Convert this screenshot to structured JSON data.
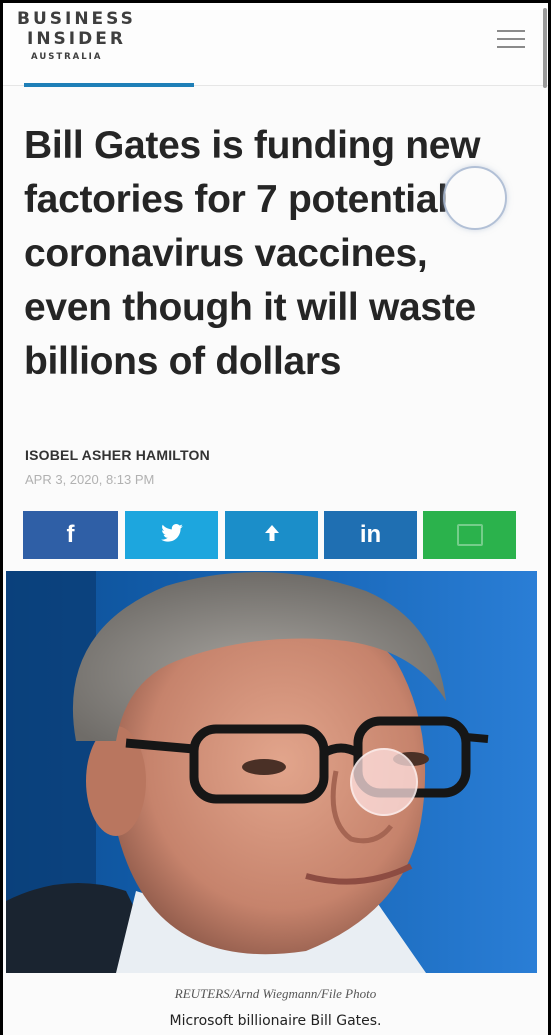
{
  "header": {
    "logo": {
      "line1": "BUSINESS",
      "line2": "INSIDER",
      "line3": "AUSTRALIA"
    },
    "menu_icon": "hamburger-menu-icon"
  },
  "article": {
    "headline": "Bill Gates is funding new factories for 7 potential coronavirus vaccines, even though it will waste billions of dollars",
    "author": "ISOBEL ASHER HAMILTON",
    "date": "APR 3, 2020, 8:13 PM"
  },
  "share": {
    "facebook": {
      "label": "f",
      "icon": "facebook-icon",
      "color": "#2f5fa6"
    },
    "twitter": {
      "label": "",
      "icon": "twitter-icon",
      "color": "#1da6de"
    },
    "share": {
      "label": "",
      "icon": "share-arrow-icon",
      "color": "#1b8ec9"
    },
    "linkedin": {
      "label": "in",
      "icon": "linkedin-icon",
      "color": "#1f6fb2"
    },
    "other": {
      "label": "",
      "icon": "message-icon",
      "color": "#2bb24c"
    }
  },
  "photo": {
    "credit": "REUTERS/Arnd Wiegmann/File Photo",
    "caption": "Microsoft billionaire Bill Gates."
  }
}
